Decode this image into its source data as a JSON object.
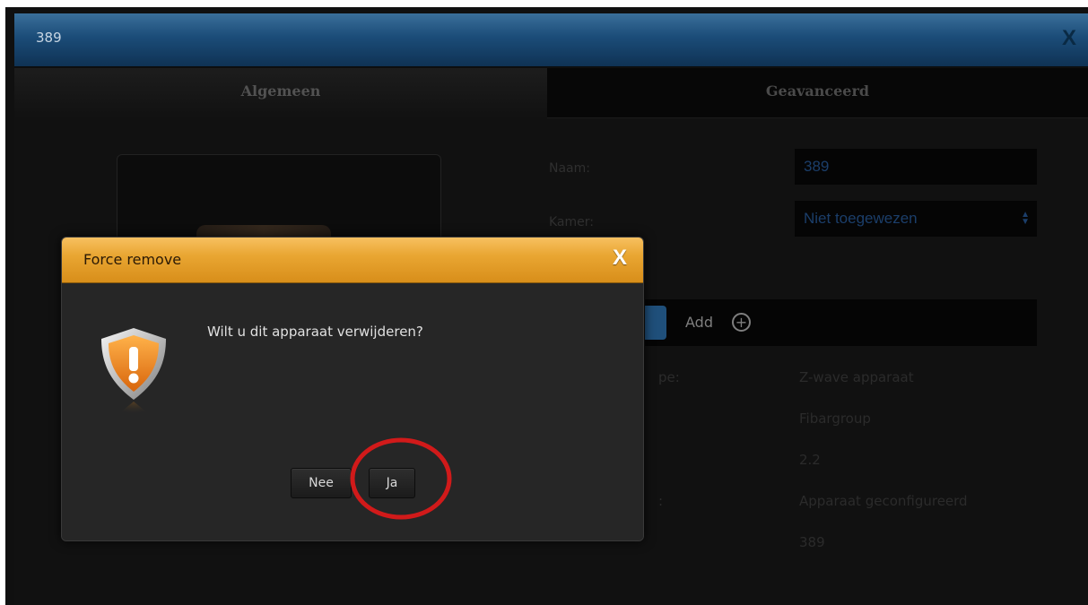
{
  "window": {
    "title": "389",
    "close_label": "X"
  },
  "tabs": [
    {
      "label": "Algemeen",
      "active": true
    },
    {
      "label": "Geavanceerd",
      "active": false
    }
  ],
  "form": {
    "name_label": "Naam:",
    "name_value": "389",
    "room_label": "Kamer:",
    "room_value": "Niet toegewezen",
    "add_label": "Add",
    "rows": [
      {
        "label": "pe:",
        "value": "Z-wave apparaat"
      },
      {
        "label": "",
        "value": "Fibargroup"
      },
      {
        "label": "",
        "value": "2.2"
      },
      {
        "label": ":",
        "value": "Apparaat geconfigureerd"
      },
      {
        "label": "",
        "value": "389"
      }
    ]
  },
  "dialog": {
    "title": "Force remove",
    "close_label": "X",
    "message": "Wilt u dit apparaat verwijderen?",
    "no_label": "Nee",
    "yes_label": "Ja",
    "icon": "warning-shield-icon"
  },
  "colors": {
    "titlebar": "#1b4c78",
    "dialog_header": "#e9a632",
    "highlight": "#d11a1a"
  }
}
